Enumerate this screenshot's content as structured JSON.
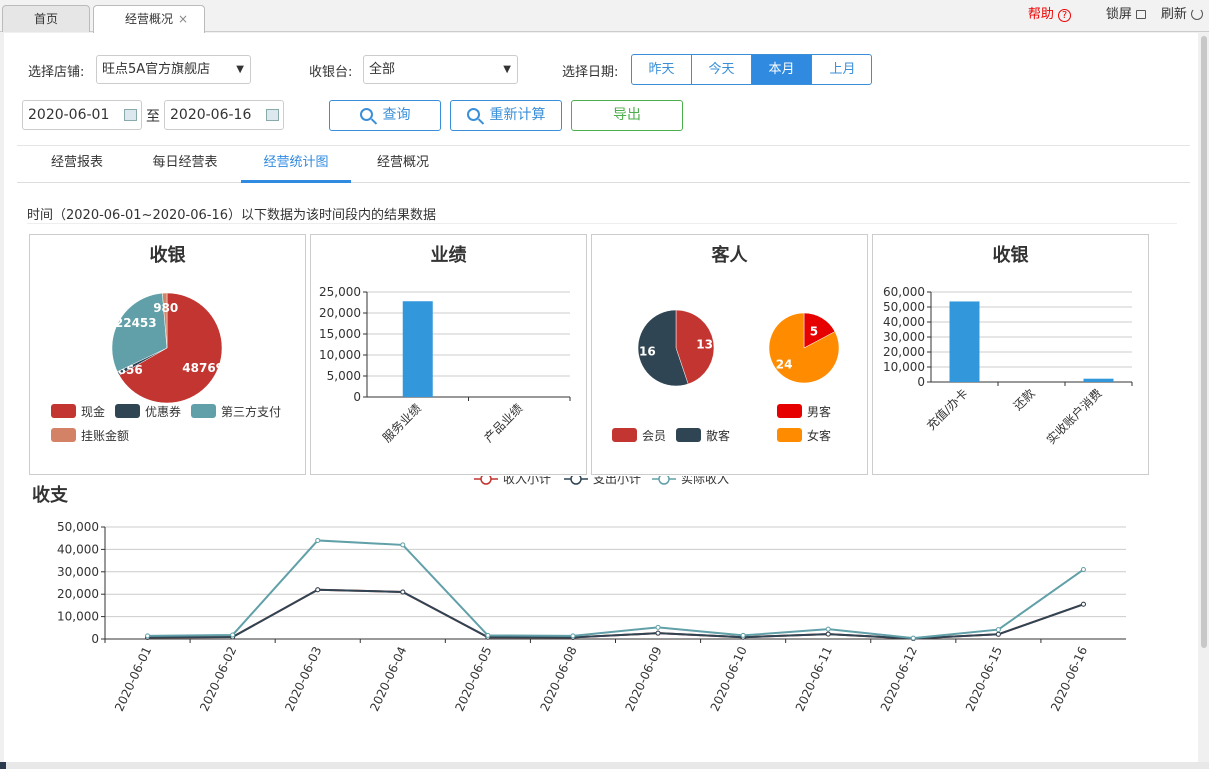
{
  "tabs": {
    "home": "首页",
    "current": "经营概况",
    "close": "×"
  },
  "toolbar": {
    "help": "帮助",
    "help_icon": "?",
    "lock": "锁屏",
    "refresh": "刷新"
  },
  "filters": {
    "store_label": "选择店铺:",
    "store_value": "旺点5A官方旗舰店",
    "cashier_label": "收银台:",
    "cashier_value": "全部",
    "date_label": "选择日期:",
    "date_options": [
      "昨天",
      "今天",
      "本月",
      "上月"
    ],
    "date_selected": "本月",
    "start_date": "2020-06-01",
    "to": "至",
    "end_date": "2020-06-16",
    "query": "查询",
    "recalc": "重新计算",
    "export": "导出"
  },
  "subtabs": [
    "经营报表",
    "每日经营表",
    "经营统计图",
    "经营概况"
  ],
  "subtab_selected": "经营统计图",
  "caption": "时间（2020-06-01~2020-06-16）以下数据为该时间段内的结果数据",
  "colors": {
    "accent": "#2f8ae0",
    "cash": "#c23531",
    "coupon": "#2f4554",
    "third": "#61a0a8",
    "credit": "#d48265",
    "male": "#e60000",
    "female": "#ff8c00",
    "bar": "#3398db",
    "income": "#c23531",
    "expense": "#2f4554",
    "actual": "#61a0a8"
  },
  "chart_data": [
    {
      "type": "pie",
      "title": "收银",
      "slices": [
        {
          "name": "现金",
          "value": 48769
        },
        {
          "name": "优惠券",
          "value": 856
        },
        {
          "name": "第三方支付",
          "value": 22453
        },
        {
          "name": "挂账金额",
          "value": 980
        }
      ]
    },
    {
      "type": "bar",
      "title": "业绩",
      "categories": [
        "服务业绩",
        "产品业绩"
      ],
      "values": [
        22800,
        0
      ],
      "yticks": [
        "0",
        "5,000",
        "10,000",
        "15,000",
        "20,000",
        "25,000"
      ],
      "ylim": [
        0,
        25000
      ]
    },
    {
      "type": "pie",
      "title": "客人",
      "pies": [
        {
          "slices": [
            {
              "name": "会员",
              "value": 13
            },
            {
              "name": "散客",
              "value": 16
            }
          ]
        },
        {
          "slices": [
            {
              "name": "男客",
              "value": 5
            },
            {
              "name": "女客",
              "value": 24
            }
          ]
        }
      ]
    },
    {
      "type": "bar",
      "title": "收银",
      "categories": [
        "充值/办卡",
        "还款",
        "实收账户消费"
      ],
      "values": [
        53700,
        0,
        2200
      ],
      "yticks": [
        "0",
        "10,000",
        "20,000",
        "30,000",
        "40,000",
        "50,000",
        "60,000"
      ],
      "ylim": [
        0,
        60000
      ]
    },
    {
      "type": "line",
      "title": "收支",
      "x": [
        "2020-06-01",
        "2020-06-02",
        "2020-06-03",
        "2020-06-04",
        "2020-06-05",
        "2020-06-08",
        "2020-06-09",
        "2020-06-10",
        "2020-06-11",
        "2020-06-12",
        "2020-06-15",
        "2020-06-16"
      ],
      "series": [
        {
          "name": "收入小计",
          "values": [
            700,
            900,
            22000,
            21000,
            800,
            700,
            2600,
            800,
            2200,
            200,
            2100,
            15500
          ]
        },
        {
          "name": "支出小计",
          "values": [
            700,
            900,
            22000,
            21000,
            800,
            700,
            2600,
            800,
            2200,
            200,
            2100,
            15500
          ]
        },
        {
          "name": "实际收入",
          "values": [
            1400,
            1800,
            44000,
            42000,
            1600,
            1400,
            5200,
            1600,
            4400,
            400,
            4200,
            31000
          ]
        }
      ],
      "yticks": [
        "0",
        "10,000",
        "20,000",
        "30,000",
        "40,000",
        "50,000"
      ],
      "ylim": [
        0,
        50000
      ]
    }
  ]
}
